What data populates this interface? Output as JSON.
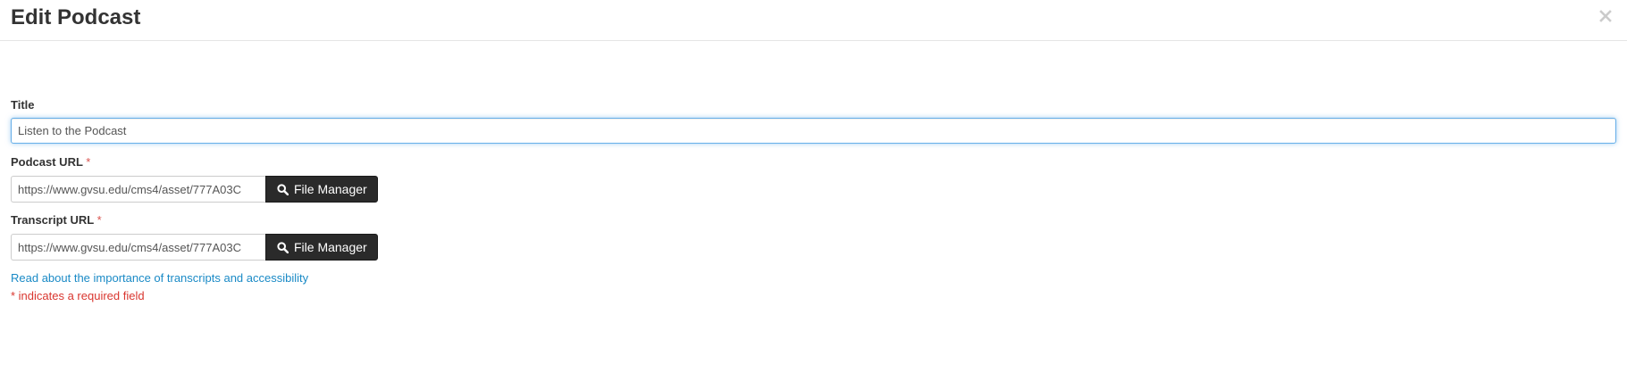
{
  "dialog": {
    "title": "Edit Podcast",
    "close_symbol": "×"
  },
  "form": {
    "title_field": {
      "label": "Title",
      "value": "Listen to the Podcast"
    },
    "podcast_url": {
      "label": "Podcast URL",
      "required_marker": "*",
      "value": "https://www.gvsu.edu/cms4/asset/777A03C",
      "button_label": "File Manager",
      "button_icon": "search-icon"
    },
    "transcript_url": {
      "label": "Transcript URL",
      "required_marker": "*",
      "value": "https://www.gvsu.edu/cms4/asset/777A03C",
      "button_label": "File Manager",
      "button_icon": "search-icon"
    },
    "accessibility_link": "Read about the importance of transcripts and accessibility",
    "required_note": "* indicates a required field"
  },
  "colors": {
    "link": "#1a8ac6",
    "required": "#d9362f",
    "button_bg": "#2a2a2a",
    "focus_border": "#66afe9"
  }
}
